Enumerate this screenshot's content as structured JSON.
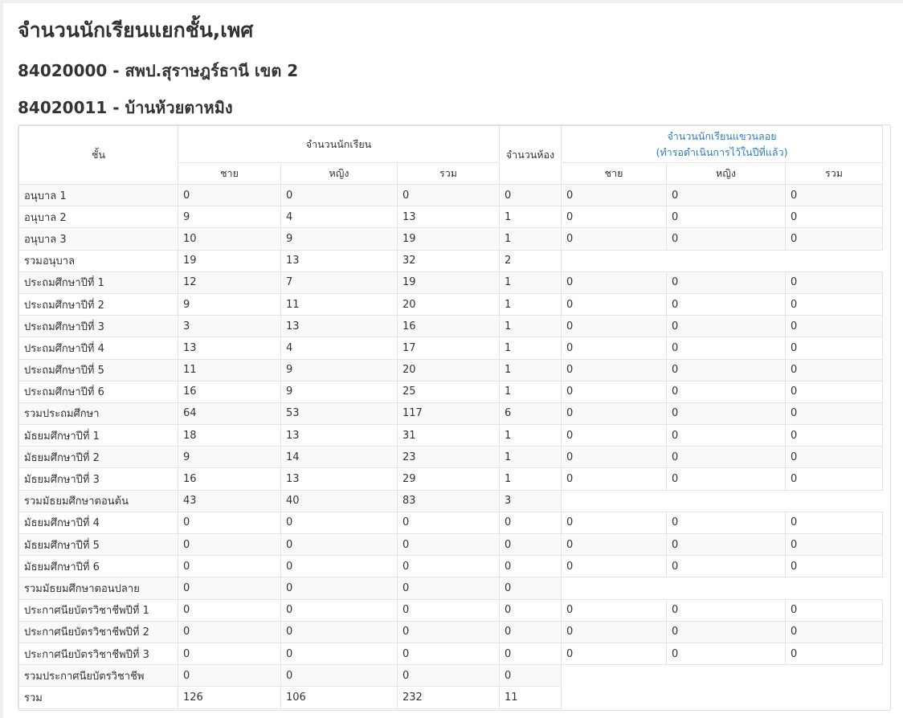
{
  "title": "จำนวนนักเรียนแยกชั้น,เพศ",
  "area": "84020000 - สพป.สุราษฎร์ธานี เขต 2",
  "school": "84020011 - บ้านห้วยตาหมิง",
  "headers": {
    "grade": "ชั้น",
    "students": "จำนวนนักเรียน",
    "rooms": "จำนวนห้อง",
    "floating_line1": "จำนวนนักเรียนแขวนลอย",
    "floating_line2": "(ทำรอดำเนินการไว้ในปีที่แล้ว)",
    "male": "ชาย",
    "female": "หญิง",
    "total": "รวม",
    "f_male": "ชาย",
    "f_female": "หญิง",
    "f_total": "รวม"
  },
  "rows": [
    {
      "grade": "อนุบาล 1",
      "male": "0",
      "female": "0",
      "total": "0",
      "rooms": "0",
      "f": [
        "0",
        "0",
        "0"
      ]
    },
    {
      "grade": "อนุบาล 2",
      "male": "9",
      "female": "4",
      "total": "13",
      "rooms": "1",
      "f": [
        "0",
        "0",
        "0"
      ]
    },
    {
      "grade": "อนุบาล 3",
      "male": "10",
      "female": "9",
      "total": "19",
      "rooms": "1",
      "f": [
        "0",
        "0",
        "0"
      ]
    },
    {
      "grade": "รวมอนุบาล",
      "male": "19",
      "female": "13",
      "total": "32",
      "rooms": "2",
      "f": null
    },
    {
      "grade": "ประถมศึกษาปีที่ 1",
      "male": "12",
      "female": "7",
      "total": "19",
      "rooms": "1",
      "f": [
        "0",
        "0",
        "0"
      ]
    },
    {
      "grade": "ประถมศึกษาปีที่ 2",
      "male": "9",
      "female": "11",
      "total": "20",
      "rooms": "1",
      "f": [
        "0",
        "0",
        "0"
      ]
    },
    {
      "grade": "ประถมศึกษาปีที่ 3",
      "male": "3",
      "female": "13",
      "total": "16",
      "rooms": "1",
      "f": [
        "0",
        "0",
        "0"
      ]
    },
    {
      "grade": "ประถมศึกษาปีที่ 4",
      "male": "13",
      "female": "4",
      "total": "17",
      "rooms": "1",
      "f": [
        "0",
        "0",
        "0"
      ]
    },
    {
      "grade": "ประถมศึกษาปีที่ 5",
      "male": "11",
      "female": "9",
      "total": "20",
      "rooms": "1",
      "f": [
        "0",
        "0",
        "0"
      ]
    },
    {
      "grade": "ประถมศึกษาปีที่ 6",
      "male": "16",
      "female": "9",
      "total": "25",
      "rooms": "1",
      "f": [
        "0",
        "0",
        "0"
      ]
    },
    {
      "grade": "รวมประถมศึกษา",
      "male": "64",
      "female": "53",
      "total": "117",
      "rooms": "6",
      "f": [
        "0",
        "0",
        "0"
      ]
    },
    {
      "grade": "มัธยมศึกษาปีที่ 1",
      "male": "18",
      "female": "13",
      "total": "31",
      "rooms": "1",
      "f": [
        "0",
        "0",
        "0"
      ]
    },
    {
      "grade": "มัธยมศึกษาปีที่ 2",
      "male": "9",
      "female": "14",
      "total": "23",
      "rooms": "1",
      "f": [
        "0",
        "0",
        "0"
      ]
    },
    {
      "grade": "มัธยมศึกษาปีที่ 3",
      "male": "16",
      "female": "13",
      "total": "29",
      "rooms": "1",
      "f": [
        "0",
        "0",
        "0"
      ]
    },
    {
      "grade": "รวมมัธยมศึกษาตอนต้น",
      "male": "43",
      "female": "40",
      "total": "83",
      "rooms": "3",
      "f": null
    },
    {
      "grade": "มัธยมศึกษาปีที่ 4",
      "male": "0",
      "female": "0",
      "total": "0",
      "rooms": "0",
      "f": [
        "0",
        "0",
        "0"
      ]
    },
    {
      "grade": "มัธยมศึกษาปีที่ 5",
      "male": "0",
      "female": "0",
      "total": "0",
      "rooms": "0",
      "f": [
        "0",
        "0",
        "0"
      ]
    },
    {
      "grade": "มัธยมศึกษาปีที่ 6",
      "male": "0",
      "female": "0",
      "total": "0",
      "rooms": "0",
      "f": [
        "0",
        "0",
        "0"
      ]
    },
    {
      "grade": "รวมมัธยมศึกษาตอนปลาย",
      "male": "0",
      "female": "0",
      "total": "0",
      "rooms": "0",
      "f": null
    },
    {
      "grade": "ประกาศนียบัตรวิชาชีพปีที่ 1",
      "male": "0",
      "female": "0",
      "total": "0",
      "rooms": "0",
      "f": [
        "0",
        "0",
        "0"
      ]
    },
    {
      "grade": "ประกาศนียบัตรวิชาชีพปีที่ 2",
      "male": "0",
      "female": "0",
      "total": "0",
      "rooms": "0",
      "f": [
        "0",
        "0",
        "0"
      ]
    },
    {
      "grade": "ประกาศนียบัตรวิชาชีพปีที่ 3",
      "male": "0",
      "female": "0",
      "total": "0",
      "rooms": "0",
      "f": [
        "0",
        "0",
        "0"
      ]
    },
    {
      "grade": "รวมประกาศนียบัตรวิชาชีพ",
      "male": "0",
      "female": "0",
      "total": "0",
      "rooms": "0",
      "f": null
    },
    {
      "grade": "รวม",
      "male": "126",
      "female": "106",
      "total": "232",
      "rooms": "11",
      "f": null
    }
  ],
  "colors": {
    "link": "#2a7cc7",
    "stripe": "#f9f9f9",
    "border": "#e4e4e4"
  }
}
